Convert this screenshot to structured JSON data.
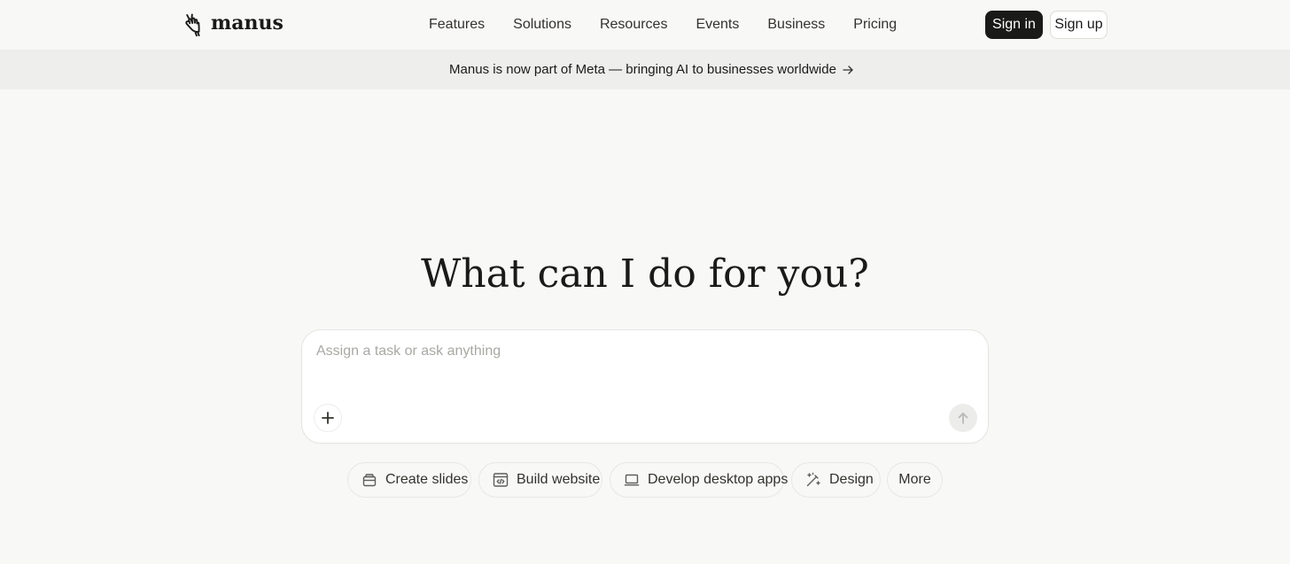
{
  "brand": {
    "name": "manus",
    "logo_icon": "hand-logo-icon"
  },
  "nav": {
    "links": [
      "Features",
      "Solutions",
      "Resources",
      "Events",
      "Business",
      "Pricing"
    ],
    "sign_in": "Sign in",
    "sign_up": "Sign up"
  },
  "announcement": {
    "text": "Manus is now part of Meta — bringing AI to businesses worldwide",
    "icon": "arrow-right-icon"
  },
  "hero": {
    "title": "What can I do for you?"
  },
  "composer": {
    "placeholder": "Assign a task or ask anything",
    "value": "",
    "attach_icon": "plus-icon",
    "send_icon": "arrow-up-icon"
  },
  "quick_actions": [
    {
      "label": "Create slides",
      "icon": "slides-icon"
    },
    {
      "label": "Build website",
      "icon": "browser-code-icon"
    },
    {
      "label": "Develop desktop apps",
      "icon": "laptop-icon"
    },
    {
      "label": "Design",
      "icon": "magic-wand-icon"
    },
    {
      "label": "More",
      "icon": ""
    }
  ],
  "colors": {
    "background": "#f8f8f7",
    "banner": "#eeeeed",
    "primary_button": "#1a1a19",
    "text": "#34322d",
    "placeholder": "#a8a8a4",
    "border": "#e5e5e2"
  }
}
